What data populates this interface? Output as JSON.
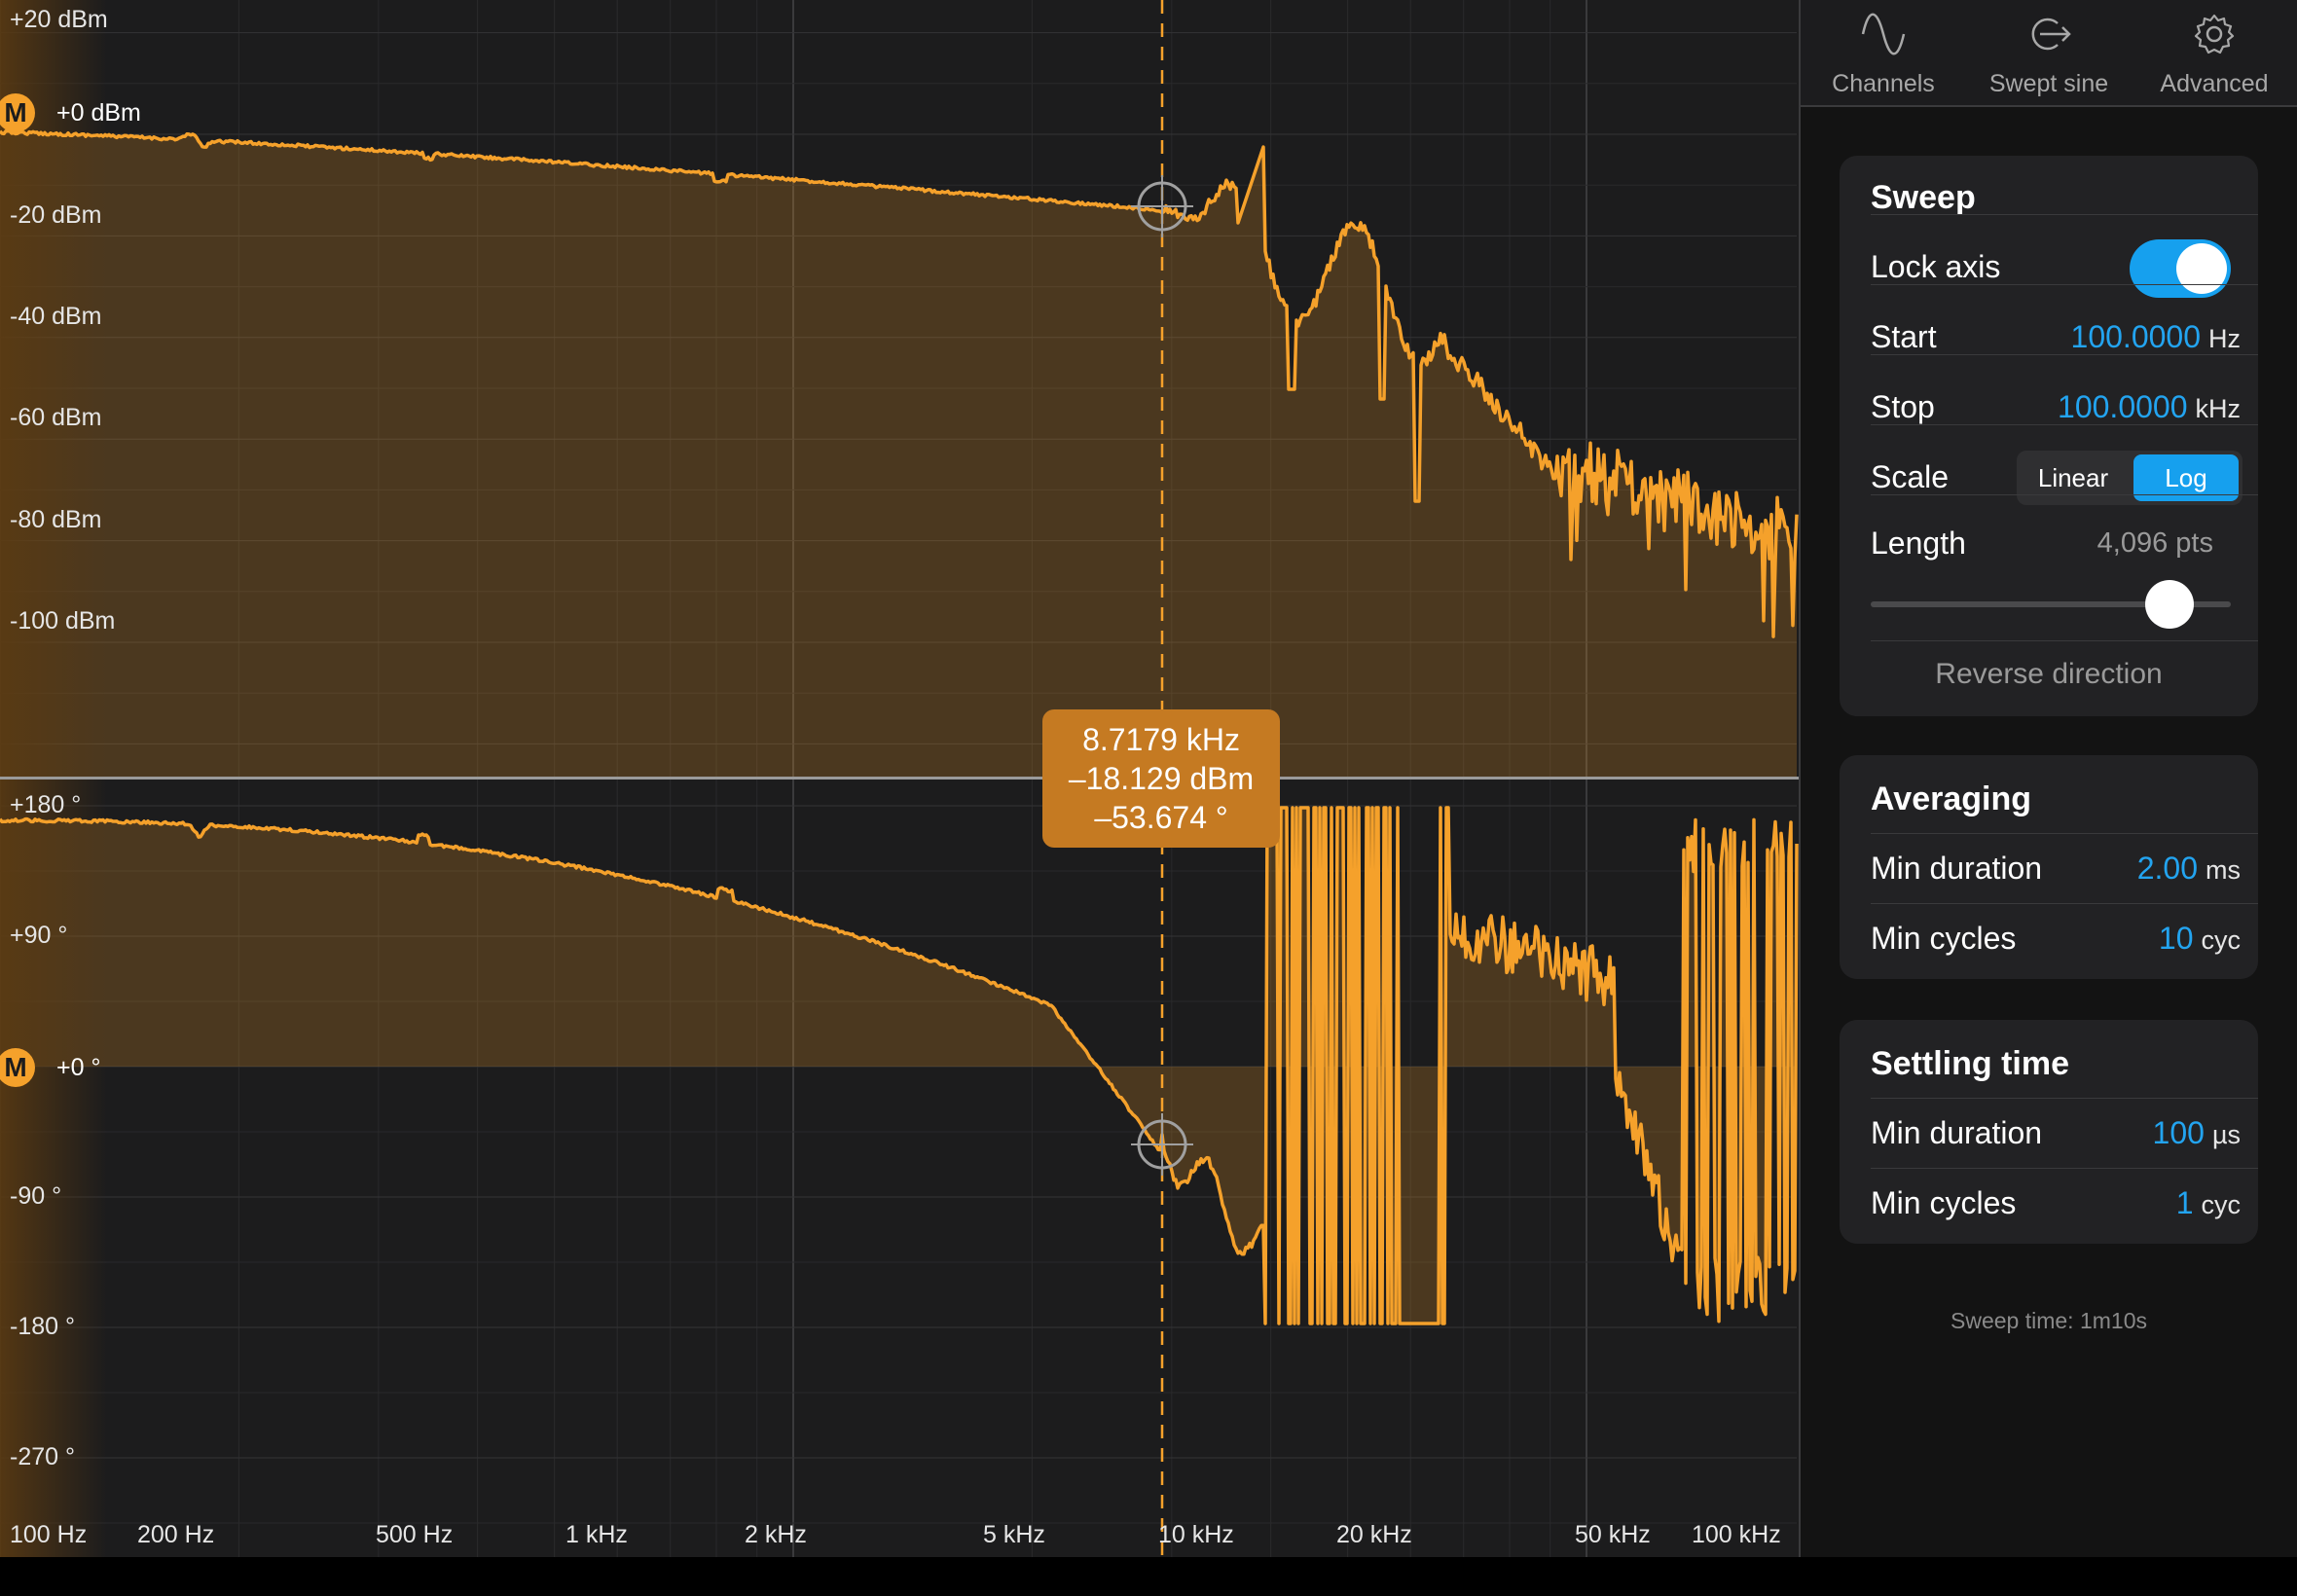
{
  "colors": {
    "trace": "#f5a12b",
    "accent": "#16a0ee",
    "tooltip": "#c57a22",
    "plot_bg": "#1c1c1d"
  },
  "magnitude_axis": {
    "labels": [
      "+20 dBm",
      "-20 dBm",
      "-40 dBm",
      "-60 dBm",
      "-80 dBm",
      "-100 dBm"
    ],
    "marker_badge": "M",
    "marker_value": "+0 dBm"
  },
  "phase_axis": {
    "labels": [
      "+180 °",
      "+90 °",
      "-90 °",
      "-180 °",
      "-270 °"
    ],
    "marker_badge": "M",
    "marker_value": "+0 °"
  },
  "frequency_axis": {
    "labels": [
      "100 Hz",
      "200 Hz",
      "500 Hz",
      "1 kHz",
      "2 kHz",
      "5 kHz",
      "10 kHz",
      "20 kHz",
      "50 kHz",
      "100 kHz"
    ]
  },
  "cursor": {
    "frequency": "8.7179 kHz",
    "magnitude": "–18.129 dBm",
    "phase": "–53.674 °"
  },
  "tabs": [
    {
      "label": "Channels",
      "icon": "sine-wave-icon"
    },
    {
      "label": "Swept sine",
      "icon": "sweep-arrow-icon"
    },
    {
      "label": "Advanced",
      "icon": "gear-icon"
    }
  ],
  "sweep": {
    "title": "Sweep",
    "lock_axis_label": "Lock axis",
    "lock_axis_on": true,
    "start_label": "Start",
    "start_value": "100.0000",
    "start_unit": "Hz",
    "stop_label": "Stop",
    "stop_value": "100.0000",
    "stop_unit": "kHz",
    "scale_label": "Scale",
    "scale_options": [
      "Linear",
      "Log"
    ],
    "scale_selected": "Log",
    "length_label": "Length",
    "length_value": "4,096 pts",
    "length_slider_fraction": 0.83,
    "reverse_label": "Reverse direction"
  },
  "averaging": {
    "title": "Averaging",
    "min_duration_label": "Min duration",
    "min_duration_value": "2.00",
    "min_duration_unit": "ms",
    "min_cycles_label": "Min cycles",
    "min_cycles_value": "10",
    "min_cycles_unit": "cyc"
  },
  "settling": {
    "title": "Settling time",
    "min_duration_label": "Min duration",
    "min_duration_value": "100",
    "min_duration_unit": "µs",
    "min_cycles_label": "Min cycles",
    "min_cycles_value": "1",
    "min_cycles_unit": "cyc"
  },
  "sweep_time": "Sweep time: 1m10s"
}
